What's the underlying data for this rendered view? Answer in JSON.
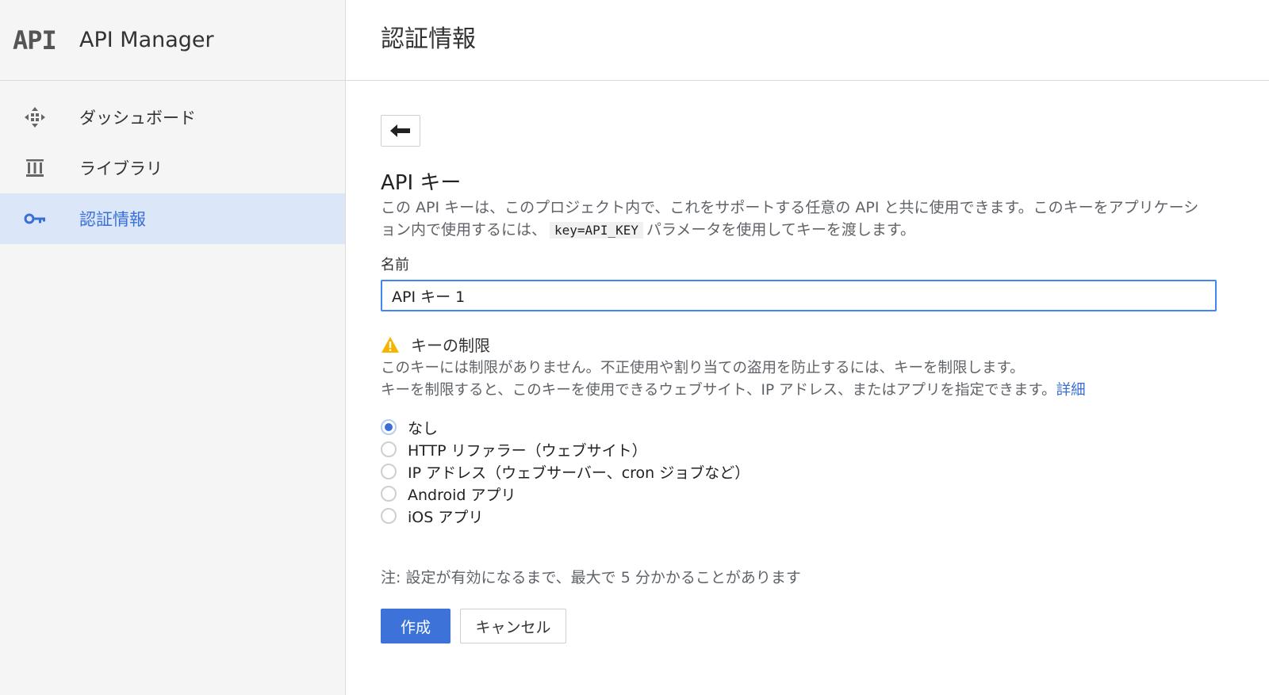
{
  "app": {
    "logo_text": "API",
    "title": "API Manager"
  },
  "sidebar": {
    "items": [
      {
        "label": "ダッシュボード",
        "icon": "dashboard-icon",
        "active": false
      },
      {
        "label": "ライブラリ",
        "icon": "library-icon",
        "active": false
      },
      {
        "label": "認証情報",
        "icon": "key-icon",
        "active": true
      }
    ]
  },
  "header": {
    "title": "認証情報"
  },
  "main": {
    "back_icon": "arrow-back-icon",
    "section_title": "API キー",
    "description_part1": "この API キーは、このプロジェクト内で、これをサポートする任意の API と共に使用できます。このキーをアプリケーション内で使用するには、",
    "description_code": "key=API_KEY",
    "description_part2": "パラメータを使用してキーを渡します。",
    "name_label": "名前",
    "name_value": "API キー 1",
    "restriction": {
      "icon": "warning-icon",
      "title": "キーの制限",
      "text_line1": "このキーには制限がありません。不正使用や割り当ての盗用を防止するには、キーを制限します。",
      "text_line2": "キーを制限すると、このキーを使用できるウェブサイト、IP アドレス、またはアプリを指定できます。",
      "link": "詳細"
    },
    "options": [
      {
        "label": "なし",
        "checked": true
      },
      {
        "label": "HTTP リファラー（ウェブサイト）",
        "checked": false
      },
      {
        "label": "IP アドレス（ウェブサーバー、cron ジョブなど）",
        "checked": false
      },
      {
        "label": "Android アプリ",
        "checked": false
      },
      {
        "label": "iOS アプリ",
        "checked": false
      }
    ],
    "note": "注: 設定が有効になるまで、最大で 5 分かかることがあります",
    "create_label": "作成",
    "cancel_label": "キャンセル"
  },
  "colors": {
    "accent": "#3d73d8",
    "active_bg": "#dbe7f8",
    "warning": "#f4b400"
  }
}
